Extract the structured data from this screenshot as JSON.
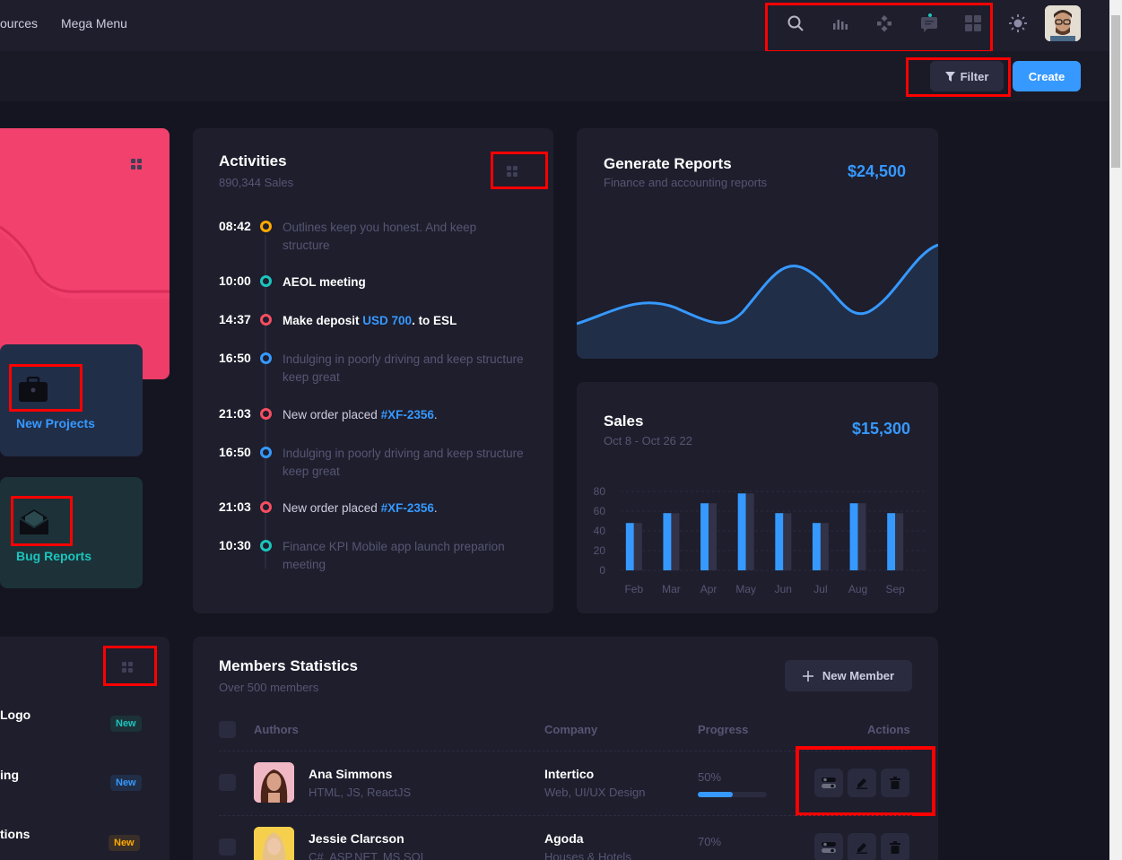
{
  "nav": {
    "link1": "ources",
    "link2": "Mega Menu"
  },
  "toolbar": {
    "filter_label": "Filter",
    "create_label": "Create"
  },
  "tiles": {
    "projects_label": "New Projects",
    "bugs_label": "Bug Reports"
  },
  "activities": {
    "title": "Activities",
    "subtitle": "890,344 Sales",
    "items": [
      {
        "time": "08:42",
        "color": "#ffa800",
        "text": "Outlines keep you honest. And keep structure"
      },
      {
        "time": "10:00",
        "color": "#1bc5bd",
        "text": "AEOL meeting"
      },
      {
        "time": "14:37",
        "color": "#f64e60",
        "pre": "Make deposit ",
        "link": "USD 700",
        "post": ". to ESL"
      },
      {
        "time": "16:50",
        "color": "#3699ff",
        "text": "Indulging in poorly driving and keep structure keep great"
      },
      {
        "time": "21:03",
        "color": "#f64e60",
        "pre": "New order placed ",
        "link": "#XF-2356",
        "post": "."
      },
      {
        "time": "16:50",
        "color": "#3699ff",
        "text": "Indulging in poorly driving and keep structure keep great"
      },
      {
        "time": "21:03",
        "color": "#f64e60",
        "pre": "New order placed ",
        "link": "#XF-2356",
        "post": "."
      },
      {
        "time": "10:30",
        "color": "#1bc5bd",
        "text": "Finance KPI Mobile app launch preparion meeting"
      }
    ]
  },
  "reports": {
    "title": "Generate Reports",
    "subtitle": "Finance and accounting reports",
    "amount": "$24,500"
  },
  "sales": {
    "title": "Sales",
    "subtitle": "Oct 8 - Oct 26 22",
    "amount": "$15,300"
  },
  "chart_data": {
    "type": "bar",
    "categories": [
      "Feb",
      "Mar",
      "Apr",
      "May",
      "Jun",
      "Jul",
      "Aug",
      "Sep"
    ],
    "series": [
      {
        "values": [
          48,
          58,
          68,
          78,
          58,
          48,
          68,
          58
        ]
      },
      {
        "values": [
          48,
          58,
          68,
          78,
          58,
          48,
          68,
          58
        ]
      }
    ],
    "yticks": [
      "80",
      "60",
      "40",
      "20",
      "0"
    ],
    "ylim": [
      0,
      80
    ]
  },
  "sidebar_list": {
    "item1": "Logo",
    "item2": "ing",
    "item3": "tions",
    "badge1": "New",
    "badge2": "New",
    "badge3": "New"
  },
  "members": {
    "title": "Members Statistics",
    "subtitle": "Over 500 members",
    "new_button": "New Member",
    "headers": {
      "authors": "Authors",
      "company": "Company",
      "progress": "Progress",
      "actions": "Actions"
    },
    "rows": [
      {
        "name": "Ana Simmons",
        "skills": "HTML, JS, ReactJS",
        "company": "Intertico",
        "company_sub": "Web, UI/UX Design",
        "progress": "50%",
        "progress_value": 0.5
      },
      {
        "name": "Jessie Clarcson",
        "skills": "C#, ASP.NET, MS SQL",
        "company": "Agoda",
        "company_sub": "Houses & Hotels",
        "progress": "70%",
        "progress_value": 0.7
      }
    ]
  }
}
